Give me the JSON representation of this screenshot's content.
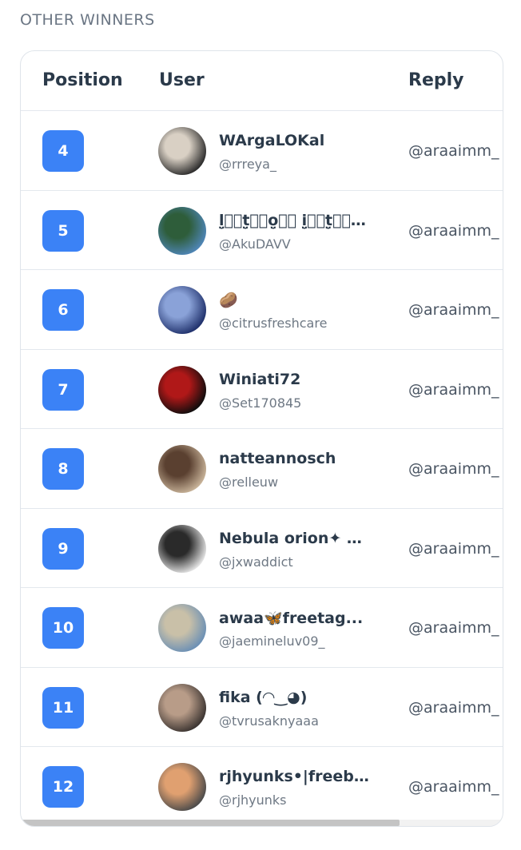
{
  "section_title": "OTHER WINNERS",
  "table": {
    "headers": {
      "position": "Position",
      "user": "User",
      "reply": "Reply"
    },
    "rows": [
      {
        "position": "4",
        "name": "WArgaLOKal",
        "handle": "@rrreya_",
        "reply": "@araaimm_",
        "avatar_colors": [
          "#2a2a2a",
          "#d9d0c4"
        ]
      },
      {
        "position": "5",
        "name": "l̤̮ᷤᷤt̤̮ᷤᷤo̤̮ᷤᷤ i̤̮ᷤᷤt̤̮ᷤᷤo̤̮ᷤᷤ",
        "handle": "@AkuDAVV",
        "reply": "@araaimm_",
        "avatar_colors": [
          "#4f86b8",
          "#2e5d3a"
        ]
      },
      {
        "position": "6",
        "name": "🥔",
        "handle": "@citrusfreshcare",
        "reply": "@araaimm_",
        "avatar_colors": [
          "#1e2f6a",
          "#8aa2d8"
        ]
      },
      {
        "position": "7",
        "name": "Winiati72",
        "handle": "@Set170845",
        "reply": "@araaimm_",
        "avatar_colors": [
          "#0d0d0d",
          "#b01818"
        ]
      },
      {
        "position": "8",
        "name": "natteannosch",
        "handle": "@relleuw",
        "reply": "@araaimm_",
        "avatar_colors": [
          "#c9b49a",
          "#5a4030"
        ]
      },
      {
        "position": "9",
        "name": "Nebula orion✦ ⋆ ...",
        "handle": "@jxwaddict",
        "reply": "@araaimm_",
        "avatar_colors": [
          "#e6e6e6",
          "#2a2a2a"
        ]
      },
      {
        "position": "10",
        "name": "awaa🦋freetag...",
        "handle": "@jaemineluv09_",
        "reply": "@araaimm_",
        "avatar_colors": [
          "#6a8fb5",
          "#c9c0a8"
        ]
      },
      {
        "position": "11",
        "name": "fika (◠‿◕)",
        "handle": "@tvrusaknyaaa",
        "reply": "@araaimm_",
        "avatar_colors": [
          "#3a3330",
          "#b89c88"
        ]
      },
      {
        "position": "12",
        "name": "rjhyunks•|freebi...",
        "handle": "@rjhyunks",
        "reply": "@araaimm_",
        "avatar_colors": [
          "#4a4a4a",
          "#e0a070"
        ]
      }
    ]
  },
  "colors": {
    "badge": "#3b82f6",
    "header_text": "#2b3a4a",
    "muted_text": "#6e7884",
    "section_title": "#6b7684"
  }
}
